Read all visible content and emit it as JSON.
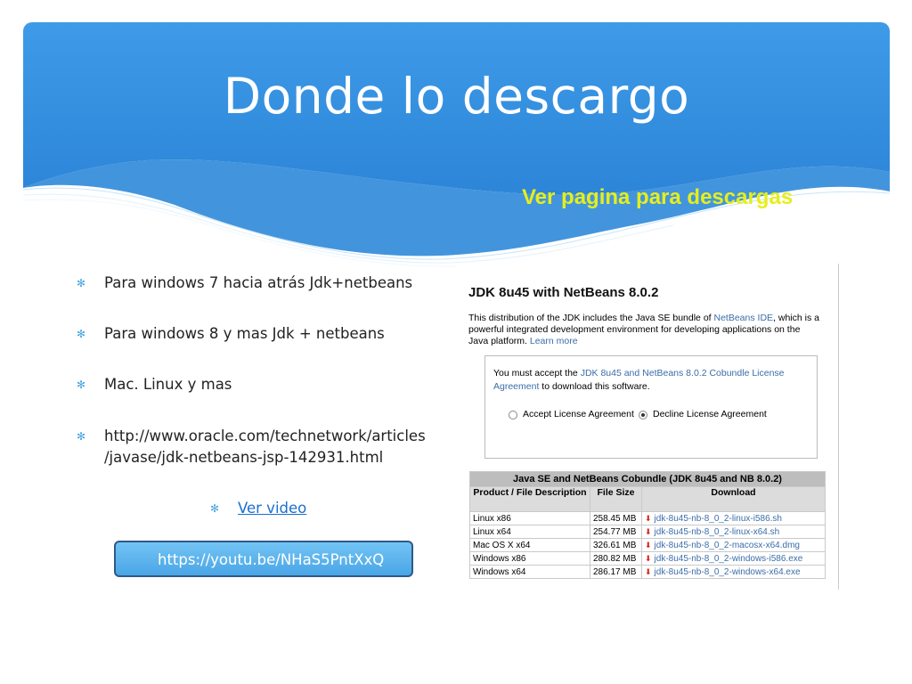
{
  "slide": {
    "title": "Donde lo descargo",
    "downloads_link": "Ver pagina para descargas",
    "colors": {
      "header_top": "#3e9be8",
      "header_bottom": "#2d85d8",
      "link_yellow": "#e6ee1c",
      "bullet_blue": "#4aa3e0"
    }
  },
  "bullets": [
    {
      "text": "Para windows 7 hacia atrás Jdk+netbeans"
    },
    {
      "text": "Para windows 8  y mas Jdk + netbeans"
    },
    {
      "text": "Mac. Linux y mas"
    },
    {
      "line1": "http://www.oracle.com/technetwork/articles",
      "line2": "/javase/jdk-netbeans-jsp-142931.html"
    }
  ],
  "video": {
    "label": "Ver video"
  },
  "youtube": {
    "url": "https://youtu.be/NHaS5PntXxQ"
  },
  "jdk_page": {
    "title": "JDK 8u45 with NetBeans 8.0.2",
    "desc_part1": "This distribution of the JDK includes the Java SE bundle of ",
    "desc_link1": "NetBeans IDE",
    "desc_part2": ", which is a powerful integrated development environment for developing applications on the Java platform.  ",
    "desc_link2": "Learn more",
    "license_part1": "You must accept the ",
    "license_link": "JDK 8u45 and NetBeans 8.0.2 Cobundle License Agreement",
    "license_part2": " to download this software.",
    "accept_label": "Accept License Agreement",
    "decline_label": "Decline License Agreement",
    "table_caption": "Java SE and NetBeans Cobundle (JDK 8u45 and NB 8.0.2)",
    "col_desc": "Product / File Description",
    "col_size": "File Size",
    "col_download": "Download",
    "rows": [
      {
        "product": "Linux x86",
        "size": "258.45 MB",
        "file": "jdk-8u45-nb-8_0_2-linux-i586.sh"
      },
      {
        "product": "Linux x64",
        "size": "254.77 MB",
        "file": "jdk-8u45-nb-8_0_2-linux-x64.sh"
      },
      {
        "product": "Mac OS X x64",
        "size": "326.61 MB",
        "file": "jdk-8u45-nb-8_0_2-macosx-x64.dmg"
      },
      {
        "product": "Windows x86",
        "size": "280.82 MB",
        "file": "jdk-8u45-nb-8_0_2-windows-i586.exe"
      },
      {
        "product": "Windows x64",
        "size": "286.17 MB",
        "file": "jdk-8u45-nb-8_0_2-windows-x64.exe"
      }
    ]
  }
}
